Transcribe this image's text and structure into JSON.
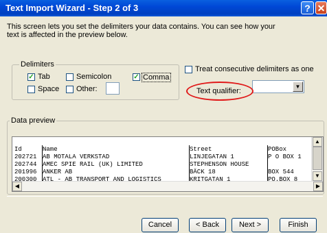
{
  "window": {
    "title": "Text Import Wizard - Step 2 of 3"
  },
  "description": "This screen lets you set the delimiters your data contains.  You can see how your text is affected in the preview below.",
  "delimiters": {
    "legend": "Delimiters",
    "options": [
      {
        "label": "Tab",
        "checked": true
      },
      {
        "label": "Semicolon",
        "checked": false
      },
      {
        "label": "Comma",
        "checked": true
      },
      {
        "label": "Space",
        "checked": false
      },
      {
        "label": "Other:",
        "checked": false,
        "value": ""
      }
    ]
  },
  "consecutive": {
    "label": "Treat consecutive delimiters as one",
    "checked": false
  },
  "qualifier": {
    "label": "Text qualifier:",
    "value": ""
  },
  "preview": {
    "legend": "Data preview",
    "columns": [
      "Id",
      "Name",
      "Street",
      "POBox"
    ],
    "rows": [
      [
        "202721",
        "AB MOTALA VERKSTAD",
        "LINJEGATAN 1",
        "P O BOX 1"
      ],
      [
        "202744",
        "AMEC SPIE RAIL (UK) LIMITED",
        "STEPHENSON HOUSE",
        ""
      ],
      [
        "201996",
        "ANKER AB",
        "BÄCK 18",
        "BOX 544"
      ],
      [
        "200300",
        "ATL - AB TRANSPORT AND LOGISTICS",
        "KRITGATAN 1",
        "PO.BOX 8"
      ]
    ]
  },
  "buttons": {
    "cancel": "Cancel",
    "back": "< Back",
    "next": "Next >",
    "finish": "Finish"
  },
  "colors": {
    "titlebar": "#0048d6",
    "annotation": "#e01818",
    "checkmark": "#21a121"
  }
}
